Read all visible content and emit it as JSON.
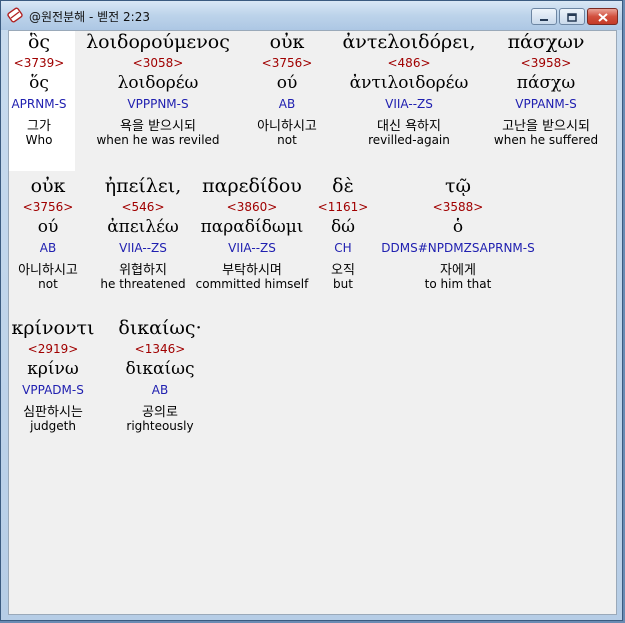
{
  "window": {
    "title": "@원전분해 - 벧전 2:23",
    "app_icon": "scroll-icon",
    "controls": {
      "minimize": "minimize-icon",
      "maximize": "maximize-icon",
      "close": "close-icon"
    }
  },
  "words": [
    {
      "greek": "ὃς",
      "strong": "<3739>",
      "lemma": "ὅς",
      "parse": "APRNM-S",
      "kor": "그가",
      "eng": "Who"
    },
    {
      "greek": "λοιδορούμενος",
      "strong": "<3058>",
      "lemma": "λοιδορέω",
      "parse": "VPPPNM-S",
      "kor": "욕을 받으시되",
      "eng": "when he was reviled"
    },
    {
      "greek": "οὐκ",
      "strong": "<3756>",
      "lemma": "ού",
      "parse": "AB",
      "kor": "아니하시고",
      "eng": "not"
    },
    {
      "greek": "ἀντελοιδόρει,",
      "strong": "<486>",
      "lemma": "ἀντιλοιδορέω",
      "parse": "VIIA--ZS",
      "kor": "대신 욕하지",
      "eng": "revilled-again"
    },
    {
      "greek": "πάσχων",
      "strong": "<3958>",
      "lemma": "πάσχω",
      "parse": "VPPANM-S",
      "kor": "고난을 받으시되",
      "eng": "when he suffered"
    },
    {
      "greek": "οὐκ",
      "strong": "<3756>",
      "lemma": "ού",
      "parse": "AB",
      "kor": "아니하시고",
      "eng": "not"
    },
    {
      "greek": "ἠπείλει,",
      "strong": "<546>",
      "lemma": "ἀπειλέω",
      "parse": "VIIA--ZS",
      "kor": "위협하지",
      "eng": "he threatened"
    },
    {
      "greek": "παρεδίδου",
      "strong": "<3860>",
      "lemma": "παραδίδωμι",
      "parse": "VIIA--ZS",
      "kor": "부탁하시며",
      "eng": "committed himself"
    },
    {
      "greek": "δὲ",
      "strong": "<1161>",
      "lemma": "δώ",
      "parse": "CH",
      "kor": "오직",
      "eng": "but"
    },
    {
      "greek": "τῷ",
      "strong": "<3588>",
      "lemma": "ὁ",
      "parse": "DDMS#NPDMZSAPRNM-S",
      "kor": "자에게",
      "eng": "to him that"
    },
    {
      "greek": "κρίνοντι",
      "strong": "<2919>",
      "lemma": "κρίνω",
      "parse": "VPPADM-S",
      "kor": "심판하시는",
      "eng": "judgeth"
    },
    {
      "greek": "δικαίως·",
      "strong": "<1346>",
      "lemma": "δικαίως",
      "parse": "AB",
      "kor": "공의로",
      "eng": "righteously"
    }
  ]
}
